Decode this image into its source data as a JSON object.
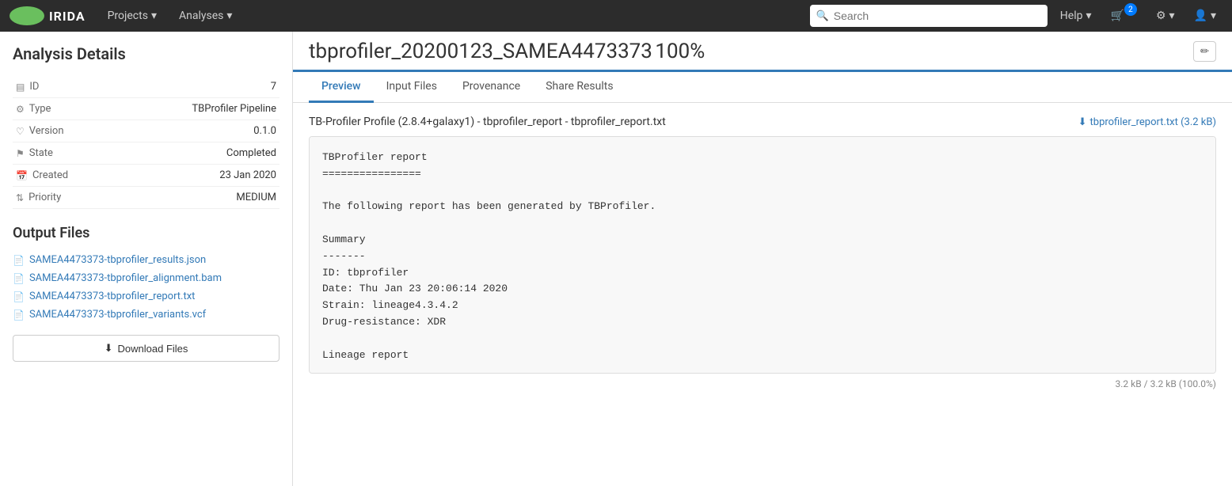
{
  "nav": {
    "logo_text": "IRIDA",
    "projects_label": "Projects",
    "analyses_label": "Analyses",
    "help_label": "Help",
    "search_placeholder": "Search",
    "cart_count": "2"
  },
  "sidebar": {
    "title": "Analysis Details",
    "details": [
      {
        "icon": "bars-icon",
        "label": "ID",
        "value": "7"
      },
      {
        "icon": "gear-icon",
        "label": "Type",
        "value": "TBProfiler Pipeline"
      },
      {
        "icon": "heart-icon",
        "label": "Version",
        "value": "0.1.0"
      },
      {
        "icon": "flag-icon",
        "label": "State",
        "value": "Completed"
      },
      {
        "icon": "calendar-icon",
        "label": "Created",
        "value": "23 Jan 2020"
      },
      {
        "icon": "sort-icon",
        "label": "Priority",
        "value": "MEDIUM"
      }
    ],
    "output_files_title": "Output Files",
    "output_files": [
      {
        "name": "SAMEA4473373-tbprofiler_results.json"
      },
      {
        "name": "SAMEA4473373-tbprofiler_alignment.bam"
      },
      {
        "name": "SAMEA4473373-tbprofiler_report.txt"
      },
      {
        "name": "SAMEA4473373-tbprofiler_variants.vcf"
      }
    ],
    "download_btn_label": "Download Files"
  },
  "analysis": {
    "title": "tbprofiler_20200123_SAMEA4473373",
    "percent": "100%",
    "tabs": [
      {
        "label": "Preview",
        "active": true
      },
      {
        "label": "Input Files",
        "active": false
      },
      {
        "label": "Provenance",
        "active": false
      },
      {
        "label": "Share Results",
        "active": false
      }
    ],
    "file_header": "TB-Profiler Profile (2.8.4+galaxy1) - tbprofiler_report - tbprofiler_report.txt",
    "download_file_label": "tbprofiler_report.txt (3.2 kB)",
    "preview_content": "TBProfiler report\n================\n\nThe following report has been generated by TBProfiler.\n\nSummary\n-------\nID: tbprofiler\nDate: Thu Jan 23 20:06:14 2020\nStrain: lineage4.3.4.2\nDrug-resistance: XDR\n\nLineage report",
    "file_size_info": "3.2 kB / 3.2 kB (100.0%)"
  }
}
